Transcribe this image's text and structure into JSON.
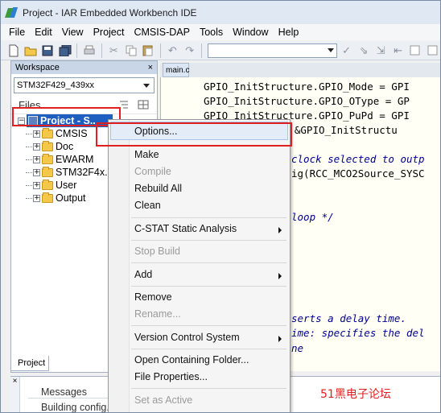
{
  "titlebar": {
    "title": "Project - IAR Embedded Workbench IDE"
  },
  "menu": [
    "File",
    "Edit",
    "View",
    "Project",
    "CMSIS-DAP",
    "Tools",
    "Window",
    "Help"
  ],
  "workspace": {
    "header": "Workspace",
    "close": "×",
    "config": "STM32F429_439xx",
    "files_label": "Files",
    "project": "Project - S...",
    "checkmark": "✓",
    "folders": [
      "CMSIS",
      "Doc",
      "EWARM",
      "STM32F4x...",
      "User",
      "Output"
    ],
    "tab": "Project"
  },
  "editor": {
    "tab": "main.c",
    "lines": [
      "GPIO_InitStructure.GPIO_Mode = GPI",
      "GPIO_InitStructure.GPIO_OType = GP",
      "GPIO_InitStructure.GPIO_PuPd = GPI",
      "           OC, &GPIO_InitStructu"
    ],
    "comments": [
      "clock selected to outp",
      "ig(RCC_MCO2Source_SYSC",
      "loop */",
      "serts a delay time.",
      "ime: specifies the del",
      "ne"
    ]
  },
  "messages": {
    "header": "Messages",
    "row": "Building config..."
  },
  "context_menu": {
    "items": [
      {
        "label": "Options...",
        "disabled": false,
        "submenu": false
      },
      {
        "label": "Make",
        "disabled": false,
        "submenu": false
      },
      {
        "label": "Compile",
        "disabled": true,
        "submenu": false
      },
      {
        "label": "Rebuild All",
        "disabled": false,
        "submenu": false
      },
      {
        "label": "Clean",
        "disabled": false,
        "submenu": false
      },
      {
        "label": "C-STAT Static Analysis",
        "disabled": false,
        "submenu": true
      },
      {
        "label": "Stop Build",
        "disabled": true,
        "submenu": false
      },
      {
        "label": "Add",
        "disabled": false,
        "submenu": true
      },
      {
        "label": "Remove",
        "disabled": false,
        "submenu": false
      },
      {
        "label": "Rename...",
        "disabled": true,
        "submenu": false
      },
      {
        "label": "Version Control System",
        "disabled": false,
        "submenu": true
      },
      {
        "label": "Open Containing Folder...",
        "disabled": false,
        "submenu": false
      },
      {
        "label": "File Properties...",
        "disabled": false,
        "submenu": false
      },
      {
        "label": "Set as Active",
        "disabled": true,
        "submenu": false
      }
    ]
  },
  "watermark": "51黑电子论坛",
  "colors": {
    "highlight": "#1f5fbf",
    "annotation": "#e02020",
    "comment": "#00008b"
  }
}
